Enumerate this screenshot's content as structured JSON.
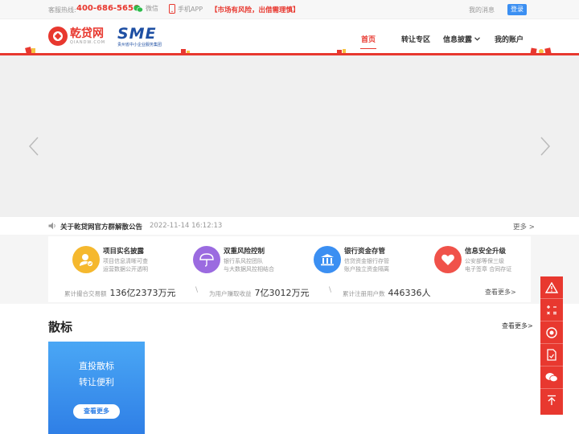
{
  "topbar": {
    "hotline_label": "客服热线:",
    "hotline_number": "400-686-5656",
    "wechat": "微信",
    "app": "手机APP",
    "risk": "【市场有风险，出借需理慎】",
    "messages": "我的消息",
    "login": "登录"
  },
  "header": {
    "logo_cn": "乾贷网",
    "logo_en": "QIANDW.COM",
    "sme_big": "SME",
    "sme_small": "贵州省中小企业服务集团",
    "nav": [
      "首页",
      "转让专区",
      "信息披露",
      "我的账户"
    ]
  },
  "notice": {
    "title": "关于乾贷网官方群解散公告",
    "time": "2022-11-14 16:12:13",
    "more": "更多 >"
  },
  "features": [
    {
      "title": "项目实名披露",
      "desc1": "项目信息清晰可查",
      "desc2": "运营数据公开透明",
      "color": "#f5b82e",
      "icon": "user-check-icon"
    },
    {
      "title": "双重风险控制",
      "desc1": "银行系风控团队",
      "desc2": "与大数据风控相结合",
      "color": "#9b6be0",
      "icon": "umbrella-icon"
    },
    {
      "title": "银行资金存管",
      "desc1": "信贷资金银行存管",
      "desc2": "账户独立资金隔离",
      "color": "#3b8ff2",
      "icon": "bank-icon"
    },
    {
      "title": "信息安全升级",
      "desc1": "公安部等保三级",
      "desc2": "电子签章 合同存证",
      "color": "#f0524a",
      "icon": "heart-icon"
    }
  ],
  "stats": {
    "s1_label": "累计撮合交易额",
    "s1_value": "136亿2373万元",
    "s2_label": "为用户赚取收益",
    "s2_value": "7亿3012万元",
    "s3_label": "累计注册用户数",
    "s3_value": "446336人",
    "more": "查看更多>"
  },
  "section": {
    "title": "散标",
    "more": "查看更多>"
  },
  "promo": {
    "line1": "直投散标",
    "line2": "转让便利",
    "button": "查看更多"
  }
}
